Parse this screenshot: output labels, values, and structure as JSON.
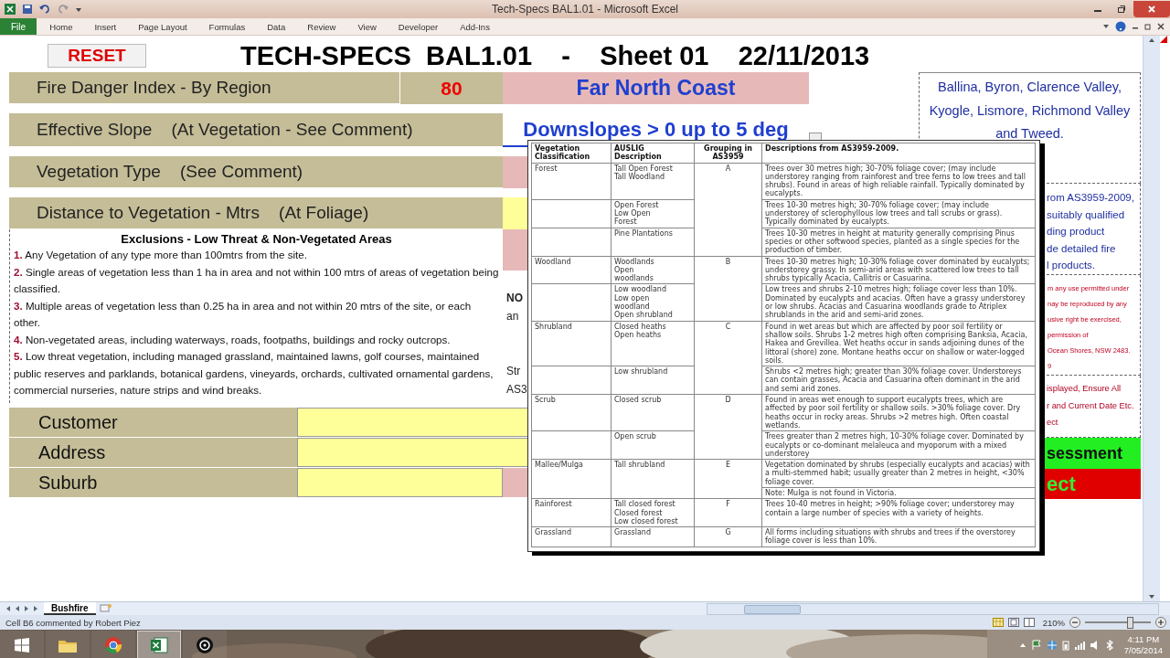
{
  "window": {
    "title": "Tech-Specs BAL1.01  -  Microsoft Excel"
  },
  "ribbon": {
    "file_tab": "File",
    "tabs": [
      "Home",
      "Insert",
      "Page Layout",
      "Formulas",
      "Data",
      "Review",
      "View",
      "Developer",
      "Add-Ins"
    ]
  },
  "sheet": {
    "reset_button": "RESET",
    "title": "TECH-SPECS  BAL1.01    -    Sheet 01    22/11/2013",
    "fire_danger": {
      "label": "Fire Danger Index - By Region",
      "value": "80",
      "region": "Far North Coast"
    },
    "slope": {
      "label": "Effective Slope    (At Vegetation - See Comment)",
      "value": "Downslopes > 0 up to 5 deg"
    },
    "vegetation_type": {
      "label": "Vegetation Type    (See Comment)"
    },
    "distance": {
      "label": "Distance to Vegetation - Mtrs    (At Foliage)"
    },
    "exclusions": {
      "title": "Exclusions - Low Threat & Non-Vegetated Areas",
      "items": [
        {
          "number": "1.",
          "text": "Any Vegetation of any type more than 100mtrs from the site."
        },
        {
          "number": "2.",
          "text": "Single areas of vegetation less than 1 ha in area and not within 100 mtrs of areas of vegetation  being classified."
        },
        {
          "number": "3.",
          "text": "Multiple areas of vegetation less than 0.25 ha in area and not within 20 mtrs of the site, or each other."
        },
        {
          "number": "4.",
          "text": "Non-vegetated areas, including waterways, roads, footpaths, buildings and rocky outcrops."
        },
        {
          "number": "5.",
          "text": "Low threat vegetation, including managed grassland, maintained lawns, golf courses, maintained public reserves and parklands, botanical gardens, vineyards, orchards, cultivated ornamental gardens, commercial nurseries, nature strips and wind breaks."
        }
      ]
    },
    "notes_fragments": [
      [
        {
          "text": "NO",
          "bold": true
        },
        {
          "text": "an",
          "bold": false
        }
      ],
      [
        {
          "text": "Str",
          "bold": false
        },
        {
          "text": "AS3",
          "bold": false
        }
      ]
    ],
    "customer_fields": [
      {
        "label": "Customer"
      },
      {
        "label": "Address"
      },
      {
        "label": "Suburb"
      }
    ],
    "councils": "Ballina, Byron, Clarence Valley, Kyogle, Lismore, Richmond Valley and Tweed.",
    "standards_fragments": [
      "rom AS3959-2009,",
      "suitably qualified",
      "ding product",
      "de detailed fire",
      "l products."
    ],
    "copyright_fragments": [
      "m any use permitted under",
      "nay be reproduced by any",
      "usive right be exercised,",
      "permission of",
      "Ocean Shores, NSW 2483.",
      "9"
    ],
    "instructions_fragments": [
      "isplayed, Ensure All",
      "r and Current Date Etc.",
      "ect"
    ],
    "assessment_fragment": "sessment",
    "result_fragment": "ect"
  },
  "comment": {
    "header": [
      "Vegetation Classification",
      "AUSLIG Description",
      "Grouping in AS3959",
      "Descriptions from AS3959-2009."
    ],
    "groups": [
      {
        "classification": "Forest",
        "grouping": "A",
        "rows": [
          {
            "auslig": "Tall Open Forest\nTall Woodland",
            "descriptions": [
              "Trees over 30 metres high; 30-70% foliage cover; (may include understorey ranging from rainforest and tree ferns to low trees and tall shrubs). Found in areas of high reliable rainfall. Typically dominated by eucalypts."
            ]
          },
          {
            "auslig": "Open Forest\nLow Open\nForest",
            "descriptions": [
              "Trees 10-30 metres high; 30-70% foliage cover; (may include understorey of sclerophyllous low trees and tall scrubs or grass). Typically dominated by eucalypts."
            ]
          },
          {
            "auslig": "Pine Plantations",
            "descriptions": [
              "Trees 10-30 metres in height at maturity generally comprising Pinus species or other softwood species, planted as a single species for the production of timber."
            ]
          }
        ]
      },
      {
        "classification": "Woodland",
        "grouping": "B",
        "rows": [
          {
            "auslig": "Woodlands\nOpen\nwoodlands",
            "descriptions": [
              "Trees 10-30 metres high; 10-30% foliage cover dominated by eucalypts; understorey grassy. In semi-arid areas with scattered low trees to tall shrubs typically Acacia, Callitris or Casuarina."
            ]
          },
          {
            "auslig": "Low woodland\nLow open\nwoodland\nOpen shrubland",
            "descriptions": [
              "Low trees and shrubs 2-10 metres high; foliage cover less than 10%. Dominated by eucalypts and acacias. Often have a grassy understorey or low shrubs. Acacias and Casuarina woodlands grade to Atriplex shrublands in the arid and semi-arid zones."
            ]
          }
        ]
      },
      {
        "classification": "Shrubland",
        "grouping": "C",
        "rows": [
          {
            "auslig": "Closed heaths\nOpen heaths",
            "descriptions": [
              "Found in wet areas but which are affected by poor soil fertility or shallow soils. Shrubs 1-2 metres high often comprising Banksia, Acacia, Hakea and Grevillea. Wet heaths occur in sands adjoining dunes of the littoral (shore) zone. Montane heaths occur on shallow or water-logged soils."
            ]
          },
          {
            "auslig": "Low shrubland",
            "descriptions": [
              "Shrubs <2 metres high; greater than 30% foliage cover. Understoreys can contain grasses, Acacia and Casuarina often dominant in the arid and semi arid zones."
            ]
          }
        ]
      },
      {
        "classification": "Scrub",
        "grouping": "D",
        "rows": [
          {
            "auslig": "Closed scrub",
            "descriptions": [
              "Found in areas wet enough to support eucalypts trees, which are affected by poor soil fertility or shallow soils. >30% foliage cover. Dry heaths occur in rocky areas.  Shrubs >2 metres high. Often coastal wetlands."
            ]
          },
          {
            "auslig": "Open scrub",
            "descriptions": [
              "Trees greater than 2 metres high, 10-30% foliage cover. Dominated by eucalypts or co-dominant melaleuca and myoporum with a  mixed understorey"
            ]
          }
        ]
      },
      {
        "classification": "Mallee/Mulga",
        "grouping": "E",
        "rows": [
          {
            "auslig": "Tall shrubland",
            "descriptions": [
              "Vegetation dominated by shrubs (especially eucalypts and acacias) with a multi-stemmed habit; usually greater than 2 metres in height, <30% foliage cover.",
              "Note: Mulga is not found in Victoria."
            ]
          }
        ]
      },
      {
        "classification": "Rainforest",
        "grouping": "F",
        "rows": [
          {
            "auslig": "Tall closed forest Closed forest\nLow closed forest",
            "descriptions": [
              "Trees 10-40 metres in height; >90% foliage cover; understorey may contain a large number of species with a variety of heights."
            ]
          }
        ]
      },
      {
        "classification": "Grassland",
        "grouping": "G",
        "rows": [
          {
            "auslig": "Grassland",
            "descriptions": [
              "All forms including situations with shrubs and trees if the overstorey foliage cover is less than 10%."
            ]
          }
        ]
      }
    ]
  },
  "sheet_tabs": [
    {
      "label": "Bushfire",
      "selected": true
    }
  ],
  "status_bar": {
    "text": "Cell B6 commented by Robert Piez",
    "zoom": "210%",
    "zoom_slider": {
      "level": 0.68
    }
  },
  "taskbar": {
    "time": "4:11 PM",
    "date": "7/05/2014"
  }
}
